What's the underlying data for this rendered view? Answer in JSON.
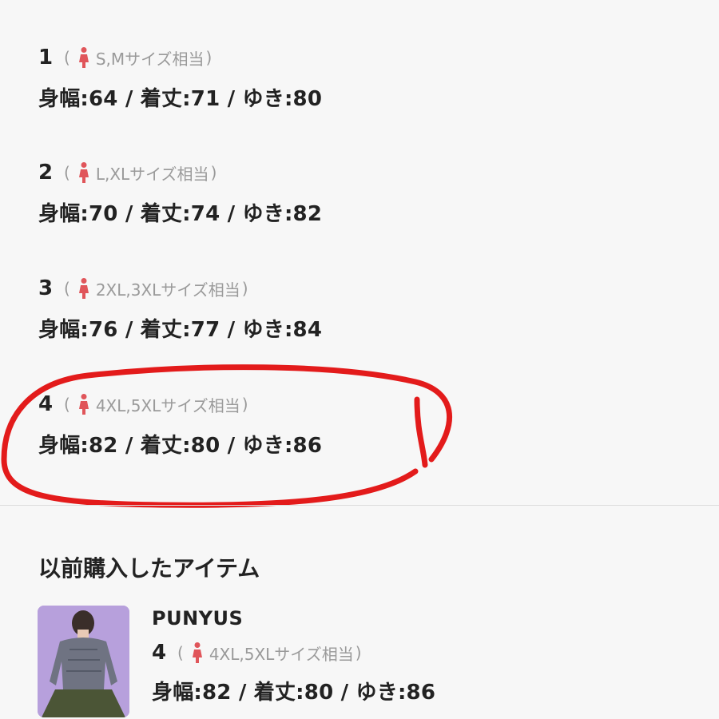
{
  "sizes": [
    {
      "number": "1",
      "label": "S,Mサイズ相当",
      "measurements": "身幅:64 / 着丈:71 / ゆき:80"
    },
    {
      "number": "2",
      "label": "L,XLサイズ相当",
      "measurements": "身幅:70 / 着丈:74 / ゆき:82"
    },
    {
      "number": "3",
      "label": "2XL,3XLサイズ相当",
      "measurements": "身幅:76 / 着丈:77 / ゆき:84"
    },
    {
      "number": "4",
      "label": "4XL,5XLサイズ相当",
      "measurements": "身幅:82 / 着丈:80 / ゆき:86"
    }
  ],
  "paren_open": "(",
  "paren_close": ")",
  "previous": {
    "title": "以前購入したアイテム",
    "brand": "PUNYUS",
    "number": "4",
    "label": "4XL,5XLサイズ相当",
    "measurements": "身幅:82 / 着丈:80 / ゆき:86"
  },
  "colors": {
    "person_icon": "#e0555a",
    "highlight_circle": "#e31b1b",
    "thumb_bg": "#b7a0dc"
  },
  "icons": {
    "size_marker": "person-icon"
  }
}
